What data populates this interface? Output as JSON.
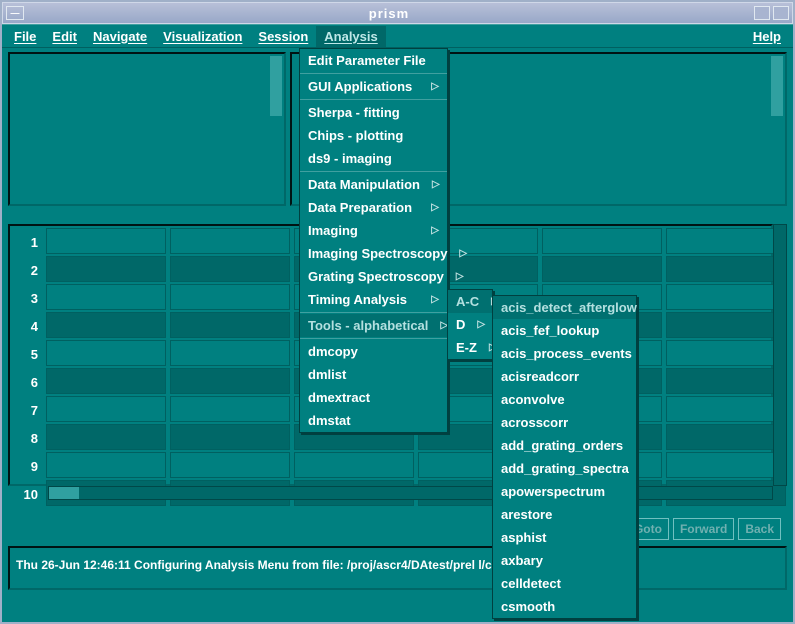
{
  "title": "prism",
  "menubar": [
    "File",
    "Edit",
    "Navigate",
    "Visualization",
    "Session",
    "Analysis"
  ],
  "help": "Help",
  "selected_menu": 5,
  "row_numbers": [
    1,
    2,
    3,
    4,
    5,
    6,
    7,
    8,
    9,
    10
  ],
  "buttons": {
    "goto": "Goto",
    "forward": "Forward",
    "back": "Back"
  },
  "status": "Thu 26-Jun 12:46:11  Configuring Analysis Menu from file:  /proj/ascr4/DAtest/prel                                                    l/ciao.ans",
  "analysis_menu": [
    {
      "label": "Edit Parameter File",
      "sub": false
    },
    {
      "sep": true
    },
    {
      "label": "GUI Applications",
      "sub": true
    },
    {
      "sep": true
    },
    {
      "label": "Sherpa - fitting",
      "sub": false
    },
    {
      "label": "Chips - plotting",
      "sub": false
    },
    {
      "label": "ds9 - imaging",
      "sub": false
    },
    {
      "sep": true
    },
    {
      "label": "Data Manipulation",
      "sub": true
    },
    {
      "label": "Data Preparation",
      "sub": true
    },
    {
      "label": "Imaging",
      "sub": true
    },
    {
      "label": "Imaging Spectroscopy",
      "sub": true
    },
    {
      "label": "Grating Spectroscopy",
      "sub": true
    },
    {
      "label": "Timing Analysis",
      "sub": true
    },
    {
      "sep": true
    },
    {
      "label": "Tools - alphabetical",
      "sub": true,
      "sel": true
    },
    {
      "sep": true
    },
    {
      "label": "dmcopy",
      "sub": false
    },
    {
      "label": "dmlist",
      "sub": false
    },
    {
      "label": "dmextract",
      "sub": false
    },
    {
      "label": "dmstat",
      "sub": false
    }
  ],
  "alpha_sub": [
    {
      "label": "A-C",
      "sub": true,
      "sel": true
    },
    {
      "label": "D",
      "sub": true
    },
    {
      "label": "E-Z",
      "sub": true
    }
  ],
  "ac_sub": [
    "acis_detect_afterglow",
    "acis_fef_lookup",
    "acis_process_events",
    "acisreadcorr",
    "aconvolve",
    "acrosscorr",
    "add_grating_orders",
    "add_grating_spectra",
    "apowerspectrum",
    "arestore",
    "asphist",
    "axbary",
    "celldetect",
    "csmooth"
  ]
}
